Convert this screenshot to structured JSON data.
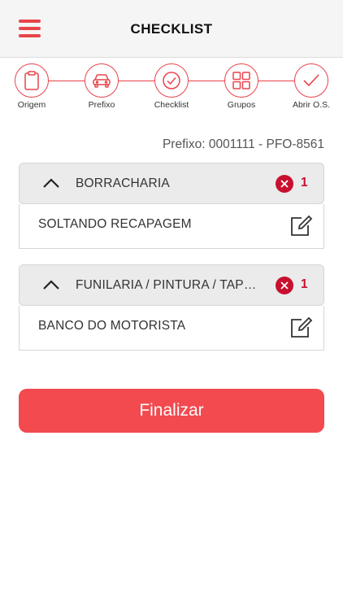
{
  "header": {
    "title": "CHECKLIST",
    "menu_icon": "hamburger-menu-icon",
    "accent_color": "#e8444a"
  },
  "steps": [
    {
      "label": "Origem",
      "icon": "clipboard-icon"
    },
    {
      "label": "Prefixo",
      "icon": "car-icon"
    },
    {
      "label": "Checklist",
      "icon": "check-circle-icon"
    },
    {
      "label": "Grupos",
      "icon": "grid-icon"
    },
    {
      "label": "Abrir O.S.",
      "icon": "checkmark-icon"
    }
  ],
  "prefix": {
    "text": "Prefixo: 0001111 - PFO-8561"
  },
  "groups": [
    {
      "title": "BORRACHARIA",
      "error_count": "1",
      "items": [
        {
          "label": "SOLTANDO RECAPAGEM"
        }
      ]
    },
    {
      "title": "FUNILARIA / PINTURA / TAPEÇARIA",
      "error_count": "1",
      "items": [
        {
          "label": "BANCO DO MOTORISTA"
        }
      ]
    }
  ],
  "actions": {
    "finalize_label": "Finalizar",
    "finalize_color": "#f24a4f",
    "error_color": "#c8102e"
  }
}
